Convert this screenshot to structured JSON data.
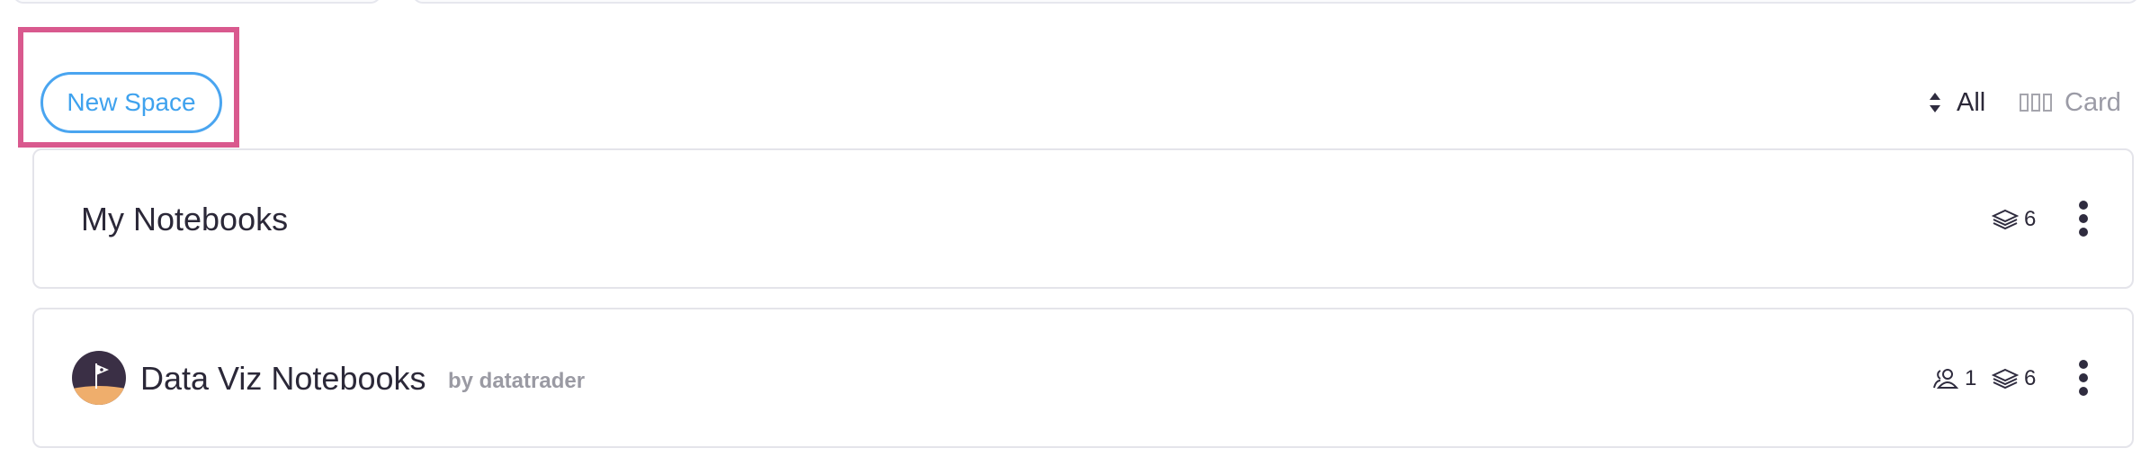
{
  "toolbar": {
    "new_space_label": "New Space",
    "sort_label": "All",
    "view_label": "Card"
  },
  "spaces": [
    {
      "title": "My Notebooks",
      "notebook_count": "6",
      "icons": [
        "layers-icon",
        "kebab-menu-icon"
      ]
    },
    {
      "title": "Data Viz Notebooks",
      "owner": "by datatrader",
      "member_count": "1",
      "notebook_count": "6",
      "icons": [
        "avatar",
        "users-icon",
        "layers-icon",
        "kebab-menu-icon"
      ]
    }
  ],
  "colors": {
    "accent_blue": "#4aa5f0",
    "highlight_pink": "#d9598e",
    "avatar_dark": "#3a2f45",
    "avatar_sand": "#efae6c"
  }
}
